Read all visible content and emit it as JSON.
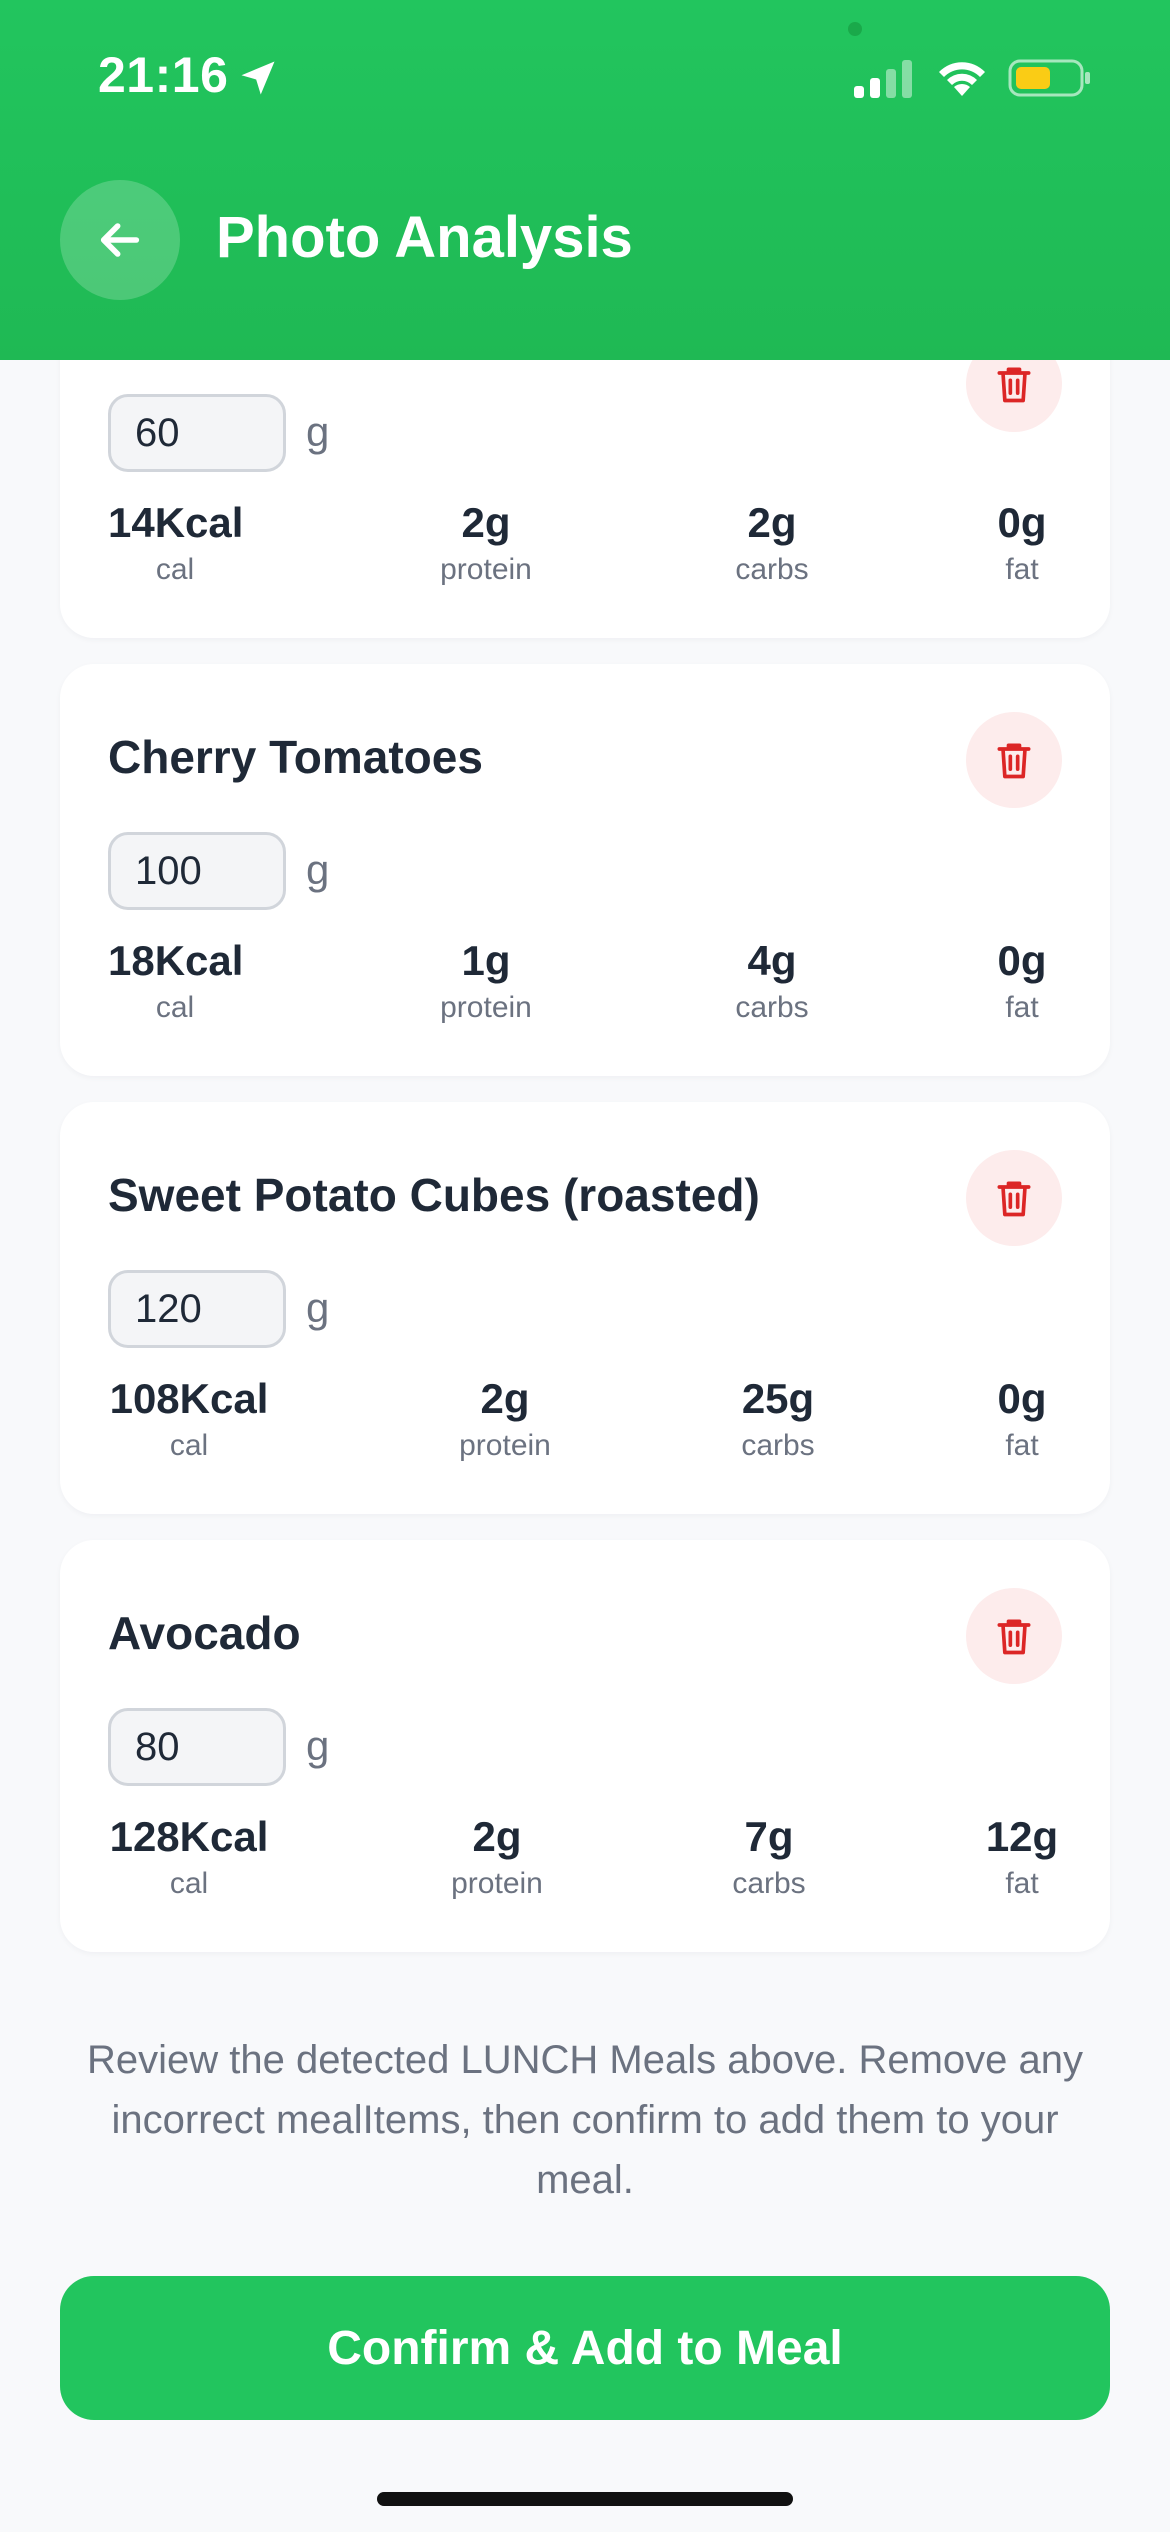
{
  "status_bar": {
    "time": "21:16"
  },
  "header": {
    "title": "Photo Analysis",
    "color": "#22c55e"
  },
  "items": [
    {
      "name": "",
      "quantity": "60",
      "unit": "g",
      "calories": "14Kcal",
      "calories_label": "cal",
      "protein": "2g",
      "protein_label": "protein",
      "carbs": "2g",
      "carbs_label": "carbs",
      "fat": "0g",
      "fat_label": "fat"
    },
    {
      "name": "Cherry Tomatoes",
      "quantity": "100",
      "unit": "g",
      "calories": "18Kcal",
      "calories_label": "cal",
      "protein": "1g",
      "protein_label": "protein",
      "carbs": "4g",
      "carbs_label": "carbs",
      "fat": "0g",
      "fat_label": "fat"
    },
    {
      "name": "Sweet Potato Cubes (roasted)",
      "quantity": "120",
      "unit": "g",
      "calories": "108Kcal",
      "calories_label": "cal",
      "protein": "2g",
      "protein_label": "protein",
      "carbs": "25g",
      "carbs_label": "carbs",
      "fat": "0g",
      "fat_label": "fat"
    },
    {
      "name": "Avocado",
      "quantity": "80",
      "unit": "g",
      "calories": "128Kcal",
      "calories_label": "cal",
      "protein": "2g",
      "protein_label": "protein",
      "carbs": "7g",
      "carbs_label": "carbs",
      "fat": "12g",
      "fat_label": "fat"
    }
  ],
  "footer": {
    "review_text": "Review the detected LUNCH Meals above. Remove any incorrect mealItems, then confirm to add them to your meal.",
    "confirm_label": "Confirm & Add to Meal"
  },
  "colors": {
    "accent": "#22c55e",
    "delete_bg": "#fdecec",
    "delete_icon": "#dc2626"
  }
}
